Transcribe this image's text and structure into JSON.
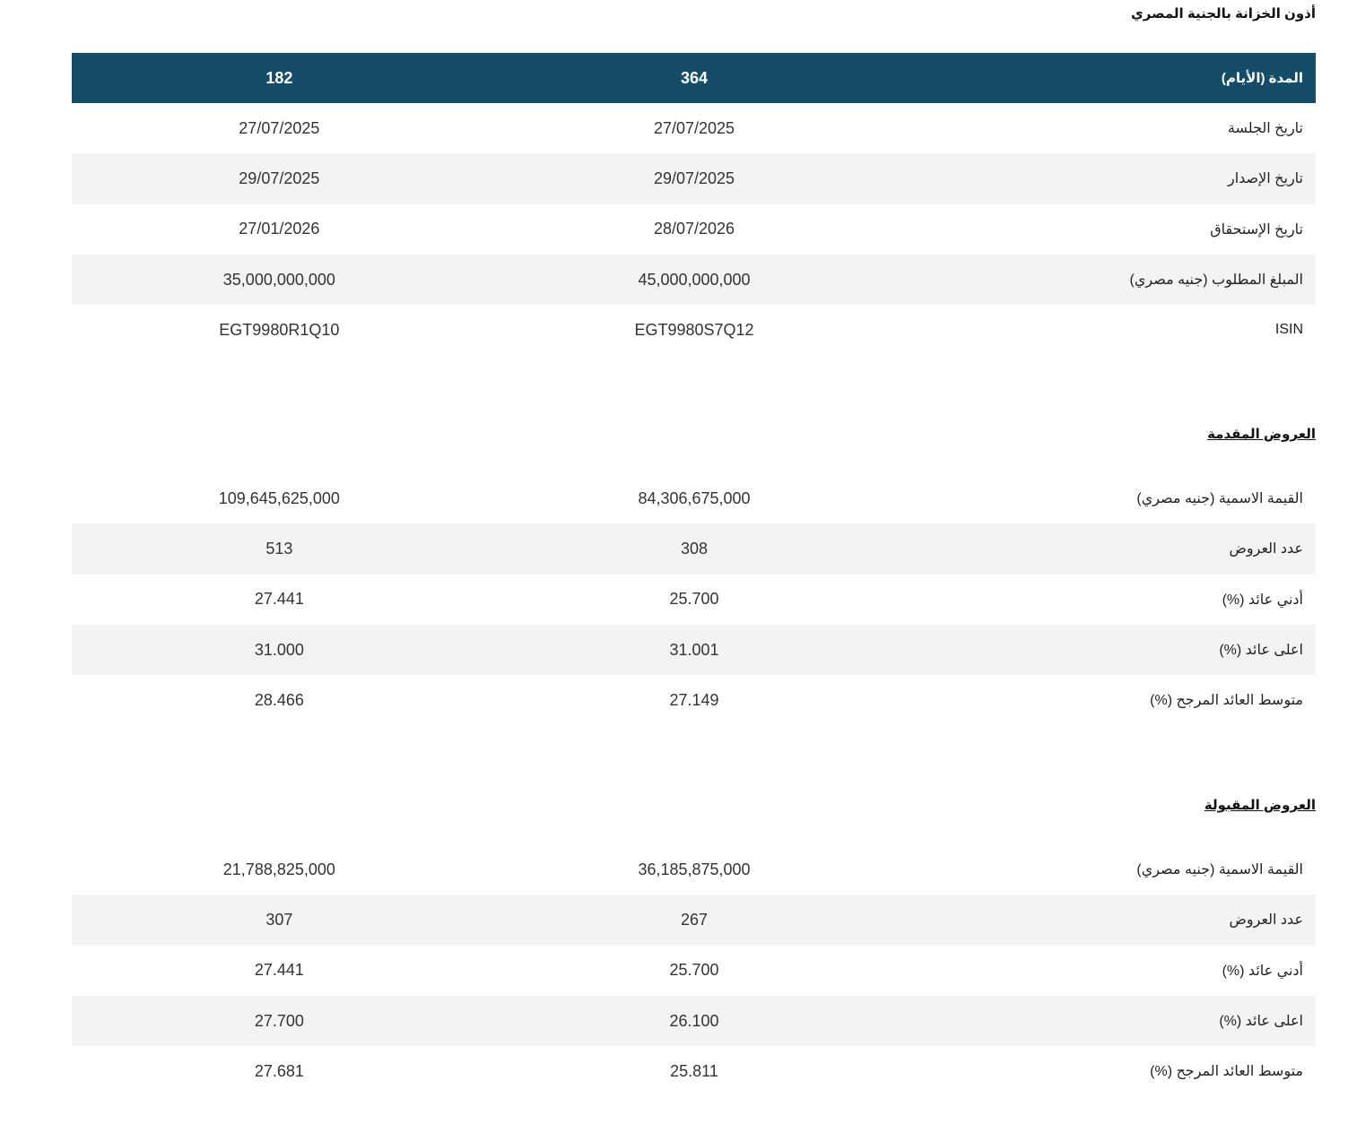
{
  "page": {
    "title": "أذون الخزانة بالجنية المصري"
  },
  "colors": {
    "header_bg": "#154c68",
    "row_alt_bg": "#f2f3f5"
  },
  "summary": {
    "header": {
      "label": "المدة (الأيام)",
      "col1": "364",
      "col2": "182"
    },
    "rows": [
      {
        "label": "تاريخ الجلسة",
        "col1": "27/07/2025",
        "col2": "27/07/2025"
      },
      {
        "label": "تاريخ الإصدار",
        "col1": "29/07/2025",
        "col2": "29/07/2025"
      },
      {
        "label": "تاريخ الإستحقاق",
        "col1": "28/07/2026",
        "col2": "27/01/2026"
      },
      {
        "label": "المبلغ المطلوب (جنيه مصري)",
        "col1": "45,000,000,000",
        "col2": "35,000,000,000"
      },
      {
        "label": "ISIN",
        "col1": "EGT9980S7Q12",
        "col2": "EGT9980R1Q10"
      }
    ]
  },
  "offered": {
    "title": "العروض المقدمة",
    "rows": [
      {
        "label": "القيمة الاسمية (جنيه مصري)",
        "col1": "84,306,675,000",
        "col2": "109,645,625,000"
      },
      {
        "label": "عدد العروض",
        "col1": "308",
        "col2": "513"
      },
      {
        "label": "أدني عائد (%)",
        "col1": "25.700",
        "col2": "27.441"
      },
      {
        "label": "اعلى عائد (%)",
        "col1": "31.001",
        "col2": "31.000"
      },
      {
        "label": "متوسط العائد المرجح (%)",
        "col1": "27.149",
        "col2": "28.466"
      }
    ]
  },
  "accepted": {
    "title": "العروض المقبولة",
    "rows": [
      {
        "label": "القيمة الاسمية (جنيه مصري)",
        "col1": "36,185,875,000",
        "col2": "21,788,825,000"
      },
      {
        "label": "عدد العروض",
        "col1": "267",
        "col2": "307"
      },
      {
        "label": "أدني عائد (%)",
        "col1": "25.700",
        "col2": "27.441"
      },
      {
        "label": "اعلى عائد (%)",
        "col1": "26.100",
        "col2": "27.700"
      },
      {
        "label": "متوسط العائد المرجح (%)",
        "col1": "25.811",
        "col2": "27.681"
      }
    ]
  }
}
